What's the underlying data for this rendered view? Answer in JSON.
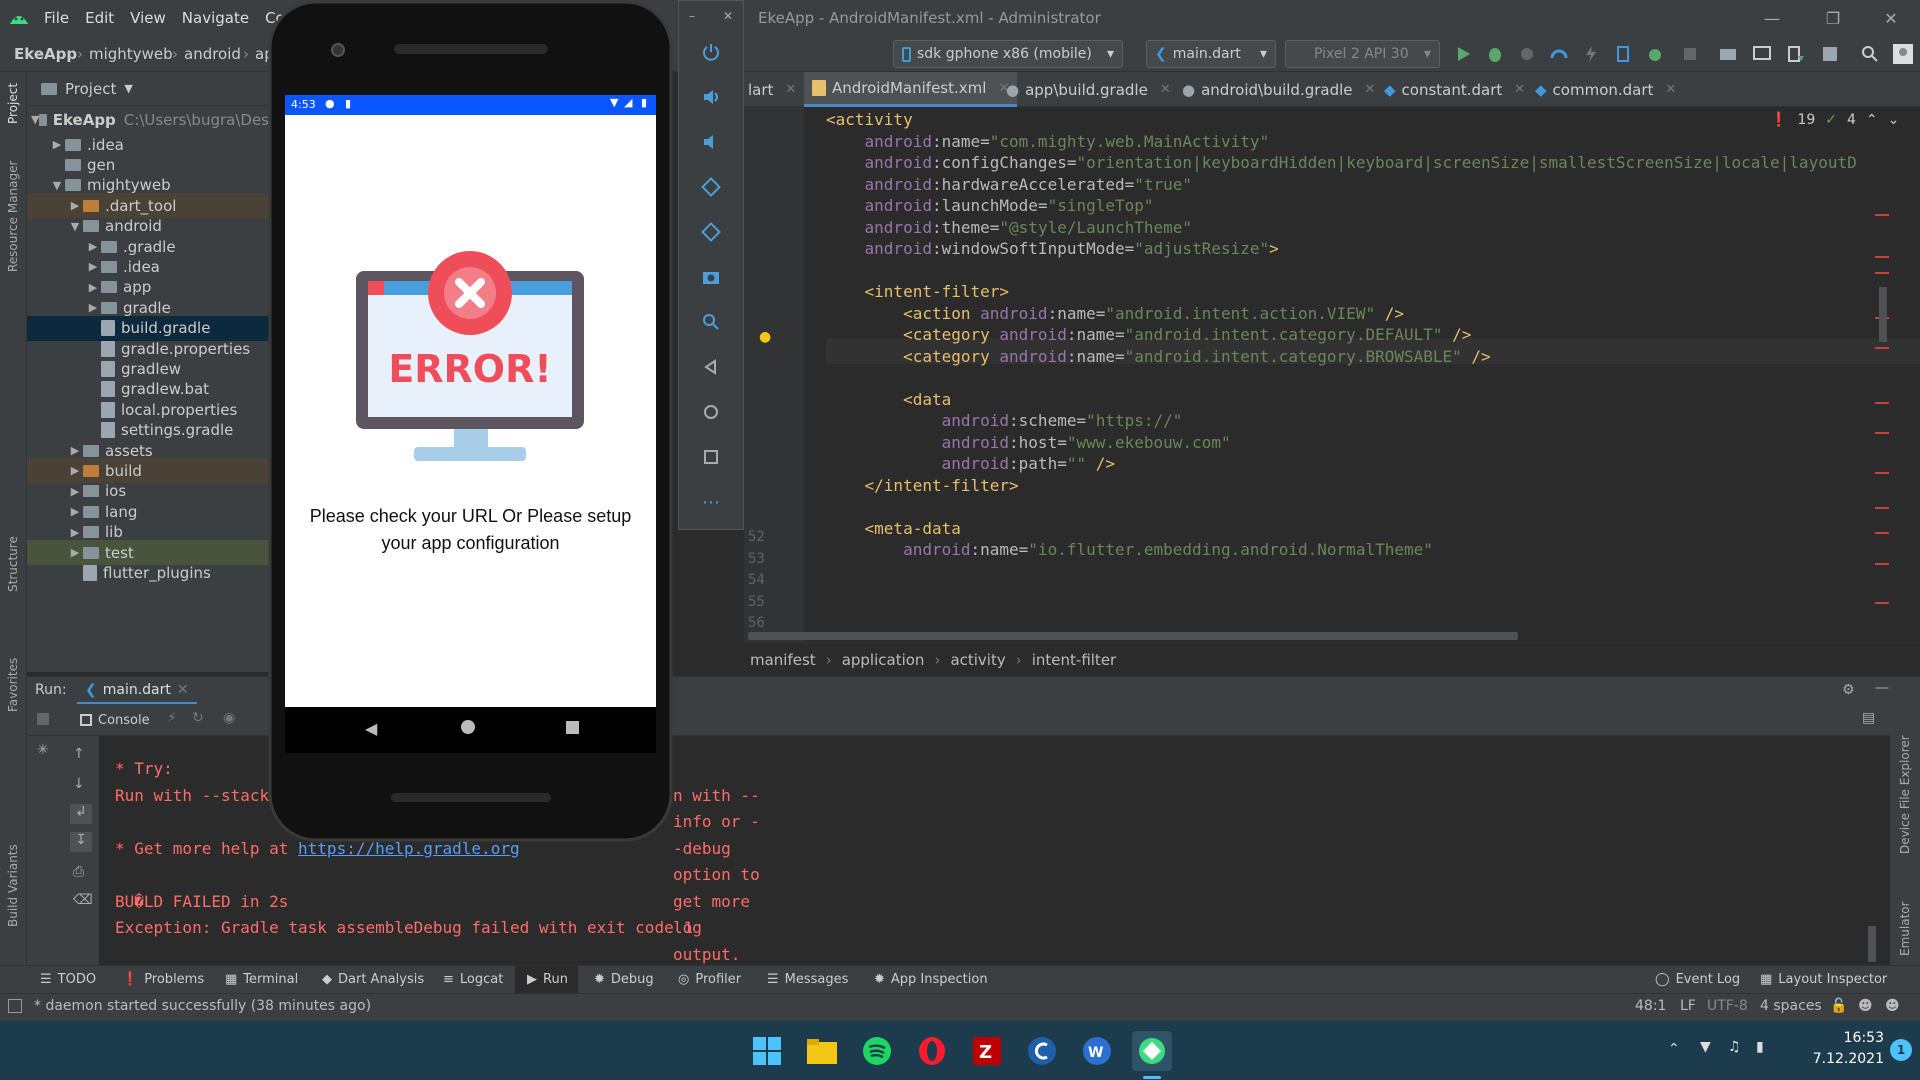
{
  "titlebar": {
    "menu": [
      "File",
      "Edit",
      "View",
      "Navigate",
      "Cod"
    ],
    "window_title": "EkeApp - AndroidManifest.xml - Administrator"
  },
  "navbar": {
    "breadcrumb": [
      "EkeApp",
      "mightyweb",
      "android",
      "ap"
    ],
    "device_selector": "sdk gphone x86 (mobile)",
    "run_config": "main.dart",
    "avd": "Pixel 2 API 30"
  },
  "project_panel": {
    "title": "Project",
    "root_name": "EkeApp",
    "root_path": "C:\\Users\\bugra\\Des",
    "items": [
      {
        "label": ".idea",
        "level": 1,
        "arrow": "right",
        "type": "folder"
      },
      {
        "label": "gen",
        "level": 1,
        "arrow": "",
        "type": "folder"
      },
      {
        "label": "mightyweb",
        "level": 1,
        "arrow": "down",
        "type": "folder"
      },
      {
        "label": ".dart_tool",
        "level": 2,
        "arrow": "right",
        "type": "folder-orange"
      },
      {
        "label": "android",
        "level": 2,
        "arrow": "down",
        "type": "folder"
      },
      {
        "label": ".gradle",
        "level": 3,
        "arrow": "right",
        "type": "folder"
      },
      {
        "label": ".idea",
        "level": 3,
        "arrow": "right",
        "type": "folder"
      },
      {
        "label": "app",
        "level": 3,
        "arrow": "right",
        "type": "folder"
      },
      {
        "label": "gradle",
        "level": 3,
        "arrow": "right",
        "type": "folder"
      },
      {
        "label": "build.gradle",
        "level": 3,
        "arrow": "",
        "type": "file",
        "selected": true
      },
      {
        "label": "gradle.properties",
        "level": 3,
        "arrow": "",
        "type": "file"
      },
      {
        "label": "gradlew",
        "level": 3,
        "arrow": "",
        "type": "file"
      },
      {
        "label": "gradlew.bat",
        "level": 3,
        "arrow": "",
        "type": "file"
      },
      {
        "label": "local.properties",
        "level": 3,
        "arrow": "",
        "type": "file"
      },
      {
        "label": "settings.gradle",
        "level": 3,
        "arrow": "",
        "type": "file"
      },
      {
        "label": "assets",
        "level": 2,
        "arrow": "right",
        "type": "folder"
      },
      {
        "label": "build",
        "level": 2,
        "arrow": "right",
        "type": "folder-orange"
      },
      {
        "label": "ios",
        "level": 2,
        "arrow": "right",
        "type": "folder"
      },
      {
        "label": "lang",
        "level": 2,
        "arrow": "right",
        "type": "folder"
      },
      {
        "label": "lib",
        "level": 2,
        "arrow": "right",
        "type": "folder"
      },
      {
        "label": "test",
        "level": 2,
        "arrow": "right",
        "type": "folder"
      },
      {
        "label": "flutter_plugins",
        "level": 2,
        "arrow": "",
        "type": "file"
      }
    ]
  },
  "left_stripe": [
    "Project",
    "Resource Manager",
    "Structure",
    "Favorites",
    "Build Variants"
  ],
  "editor": {
    "tabs": [
      "lart",
      "AndroidManifest.xml",
      "app\\build.gradle",
      "android\\build.gradle",
      "constant.dart",
      "common.dart"
    ],
    "error_count": "19",
    "warn_count": "4",
    "line_numbers": [
      "52",
      "53",
      "54",
      "55",
      "56"
    ],
    "code_lines": [
      [
        [
          "tag",
          "<activity"
        ]
      ],
      [
        [
          "ns",
          "    android"
        ],
        [
          "attr",
          ":name="
        ],
        [
          "val",
          "\"com.mighty.web.MainActivity\""
        ]
      ],
      [
        [
          "ns",
          "    android"
        ],
        [
          "attr",
          ":configChanges="
        ],
        [
          "val",
          "\"orientation|keyboardHidden|keyboard|screenSize|smallestScreenSize|locale|layoutD"
        ]
      ],
      [
        [
          "ns",
          "    android"
        ],
        [
          "attr",
          ":hardwareAccelerated="
        ],
        [
          "val",
          "\"true\""
        ]
      ],
      [
        [
          "ns",
          "    android"
        ],
        [
          "attr",
          ":launchMode="
        ],
        [
          "val",
          "\"singleTop\""
        ]
      ],
      [
        [
          "ns",
          "    android"
        ],
        [
          "attr",
          ":theme="
        ],
        [
          "val",
          "\"@style/LaunchTheme\""
        ]
      ],
      [
        [
          "ns",
          "    android"
        ],
        [
          "attr",
          ":windowSoftInputMode="
        ],
        [
          "val",
          "\"adjustResize\""
        ],
        [
          "tag",
          ">"
        ]
      ],
      [
        [
          "tag",
          ""
        ]
      ],
      [
        [
          "tag",
          "    <intent-filter>"
        ]
      ],
      [
        [
          "tag",
          "        <action "
        ],
        [
          "ns",
          "android"
        ],
        [
          "attr",
          ":name="
        ],
        [
          "val",
          "\"android.intent.action.VIEW\""
        ],
        [
          "tag",
          " />"
        ]
      ],
      [
        [
          "tag",
          "        <category "
        ],
        [
          "ns",
          "android"
        ],
        [
          "attr",
          ":name="
        ],
        [
          "val",
          "\"android.intent.category.DEFAULT\""
        ],
        [
          "tag",
          " />"
        ]
      ],
      [
        [
          "tag",
          "        <category "
        ],
        [
          "ns",
          "android"
        ],
        [
          "attr",
          ":name="
        ],
        [
          "val",
          "\"android.intent.category.BROWSABLE\""
        ],
        [
          "tag",
          " />"
        ]
      ],
      [
        [
          "tag",
          ""
        ]
      ],
      [
        [
          "tag",
          "        <data"
        ]
      ],
      [
        [
          "ns",
          "            android"
        ],
        [
          "attr",
          ":scheme="
        ],
        [
          "val",
          "\"https://\""
        ]
      ],
      [
        [
          "ns",
          "            android"
        ],
        [
          "attr",
          ":host="
        ],
        [
          "val",
          "\"www.ekebouw.com\""
        ]
      ],
      [
        [
          "ns",
          "            android"
        ],
        [
          "attr",
          ":path="
        ],
        [
          "val",
          "\"\""
        ],
        [
          "tag",
          " />"
        ]
      ],
      [
        [
          "tag",
          "    </intent-filter>"
        ]
      ],
      [
        [
          "tag",
          ""
        ]
      ],
      [
        [
          "tag",
          "    <meta-data"
        ]
      ],
      [
        [
          "ns",
          "        android"
        ],
        [
          "attr",
          ":name="
        ],
        [
          "val",
          "\"io.flutter.embedding.android.NormalTheme\""
        ]
      ]
    ],
    "breadcrumb": [
      "manifest",
      "application",
      "activity",
      "intent-filter"
    ]
  },
  "run_panel": {
    "label": "Run:",
    "tab": "main.dart",
    "console_tab": "Console",
    "lines": [
      {
        "text": "* Try:",
        "link": ""
      },
      {
        "text": "Run with --stack",
        "tail": "n with --info or --debug option to get more log output. Run with --scan to get full insights.",
        "link": ""
      },
      {
        "text": "",
        "link": ""
      },
      {
        "text": "* Get more help at ",
        "link": "https://help.gradle.org"
      },
      {
        "text": "",
        "link": ""
      },
      {
        "text": "BU�LD FAILED in 2s",
        "link": ""
      },
      {
        "text": "Exception: Gradle task assembleDebug failed with exit code 1",
        "link": ""
      }
    ]
  },
  "right_stripe": [
    "Device File Explorer",
    "Emulator"
  ],
  "bottom_tools": [
    "TODO",
    "Problems",
    "Terminal",
    "Dart Analysis",
    "Logcat",
    "Run",
    "Debug",
    "Profiler",
    "Messages",
    "App Inspection"
  ],
  "bottom_right_tools": [
    "Event Log",
    "Layout Inspector"
  ],
  "status": {
    "message": "* daemon started successfully (38 minutes ago)",
    "position": "48:1",
    "line_sep": "LF",
    "encoding": "UTF-8",
    "indent": "4 spaces"
  },
  "phone": {
    "time": "4:53",
    "error_word": "ERROR!",
    "message": "Please check your URL Or Please setup your app configuration"
  },
  "taskbar": {
    "apps": [
      "windows-start",
      "file-explorer",
      "spotify",
      "opera",
      "filezilla",
      "ccleaner",
      "wordpad",
      "android-studio"
    ],
    "clock_time": "16:53",
    "clock_date": "7.12.2021",
    "notification_count": "1"
  },
  "colors": {
    "accent_blue": "#0a57ff",
    "error_red": "#ef4d5a",
    "console_red": "#ff6b68",
    "taskbar": "#1c3b4c"
  }
}
